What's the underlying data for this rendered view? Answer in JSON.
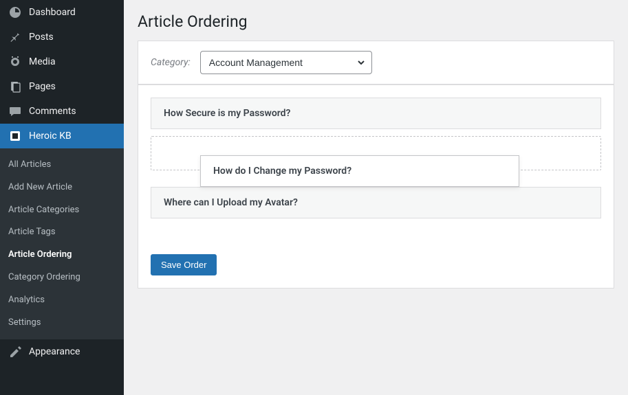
{
  "sidebar": {
    "main": [
      {
        "label": "Dashboard",
        "icon": "dashboard"
      },
      {
        "label": "Posts",
        "icon": "posts"
      },
      {
        "label": "Media",
        "icon": "media"
      },
      {
        "label": "Pages",
        "icon": "pages"
      },
      {
        "label": "Comments",
        "icon": "comments"
      },
      {
        "label": "Heroic KB",
        "icon": "heroic-kb"
      },
      {
        "label": "Appearance",
        "icon": "appearance"
      }
    ],
    "submenu": [
      {
        "label": "All Articles"
      },
      {
        "label": "Add New Article"
      },
      {
        "label": "Article Categories"
      },
      {
        "label": "Article Tags"
      },
      {
        "label": "Article Ordering"
      },
      {
        "label": "Category Ordering"
      },
      {
        "label": "Analytics"
      },
      {
        "label": "Settings"
      }
    ]
  },
  "page": {
    "title": "Article Ordering",
    "category_label": "Category:",
    "category_selected": "Account Management",
    "articles": [
      {
        "title": "How Secure is my Password?"
      },
      {
        "title": "How do I Change my Password?"
      },
      {
        "title": "Where can I Upload my Avatar?"
      }
    ],
    "save_label": "Save Order"
  }
}
